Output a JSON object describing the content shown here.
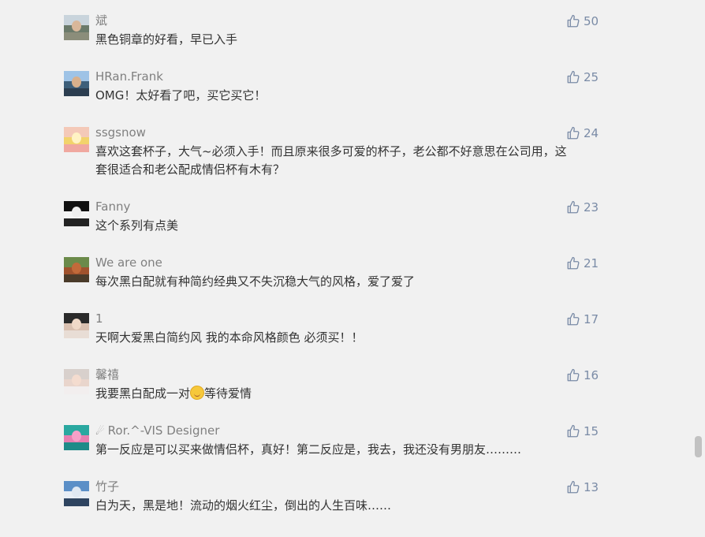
{
  "accent_color": "#7a8ba6",
  "comments": [
    {
      "user": "斌",
      "text": "黑色铜章的好看，早已入手",
      "likes": "50",
      "avatar": {
        "top": "#c9d4dc",
        "mid": "#6b7a6a",
        "bot": "#8b8d7a",
        "face": "#d9b79a"
      }
    },
    {
      "user": "HRan.Frank",
      "text": "OMG！太好看了吧，买它买它！",
      "likes": "25",
      "avatar": {
        "top": "#9ec3e6",
        "mid": "#3d5f7a",
        "bot": "#2c3e50",
        "face": "#d8b08c"
      }
    },
    {
      "user": "ssgsnow",
      "text": "喜欢这套杯子，大气~必须入手！而且原来很多可爱的杯子，老公都不好意思在公司用，这套很适合和老公配成情侣杯有木有？",
      "likes": "24",
      "avatar": {
        "top": "#f4c9b8",
        "mid": "#f2d36b",
        "bot": "#f0a8a0",
        "face": "#fff3c4"
      }
    },
    {
      "user": "Fanny",
      "text": "这个系列有点美",
      "likes": "23",
      "avatar": {
        "top": "#111111",
        "mid": "#f4f4f4",
        "bot": "#222222",
        "face": "#eeeeee"
      }
    },
    {
      "user": "We are one",
      "text": "每次黑白配就有种简约经典又不失沉稳大气的风格，爱了爱了",
      "likes": "21",
      "avatar": {
        "top": "#6b8a4a",
        "mid": "#a0522d",
        "bot": "#4a3b2a",
        "face": "#c26a3a"
      }
    },
    {
      "user": "1",
      "text": "天啊大爱黑白简约风 我的本命风格颜色 必须买！！",
      "likes": "17",
      "avatar": {
        "top": "#2a2a2a",
        "mid": "#d9c0b0",
        "bot": "#e8ddd5",
        "face": "#f0d9c8"
      }
    },
    {
      "user": "馨禧",
      "text_before": "我要黑白配成一对",
      "text_after": "等待爱情",
      "likes": "16",
      "emoji": "smile",
      "avatar": {
        "top": "#d8d0cc",
        "mid": "#e9d5cc",
        "bot": "#f2eeee",
        "face": "#f4dccf"
      }
    },
    {
      "user": "Ror.^-VIS Designer",
      "user_icon": "☄",
      "text": "第一反应是可以买来做情侣杯，真好！第二反应是，我去，我还没有男朋友………",
      "likes": "15",
      "avatar": {
        "top": "#2aa8a0",
        "mid": "#e77fb0",
        "bot": "#1e8b88",
        "face": "#f5a0c8"
      }
    },
    {
      "user": "竹子",
      "text": "白为天，黑是地！流动的烟火红尘，倒出的人生百味……",
      "likes": "13",
      "avatar": {
        "top": "#5b8fc7",
        "mid": "#e8eef5",
        "bot": "#2e4460",
        "face": "#dfe8f2"
      }
    }
  ]
}
